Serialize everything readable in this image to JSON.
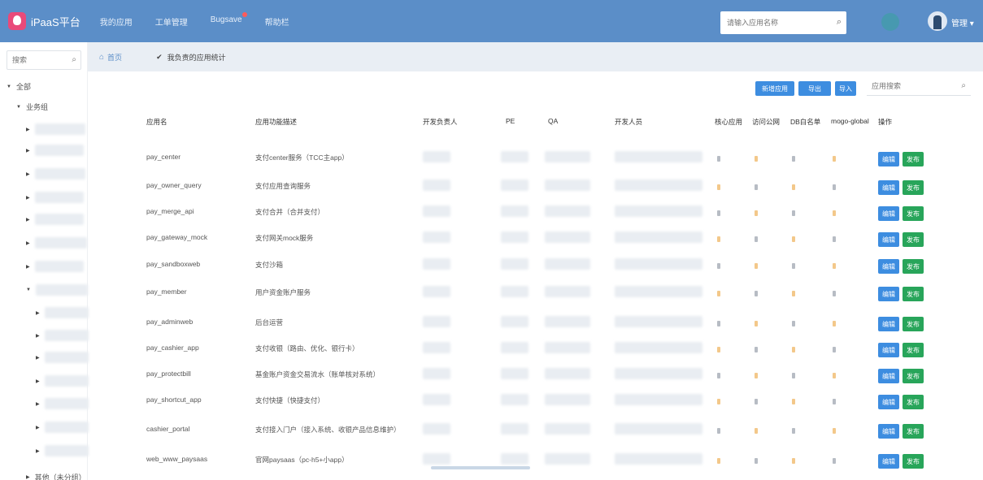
{
  "header": {
    "logo_text": "iPaaS平台",
    "nav": [
      "我的应用",
      "工单管理",
      "Bugsave",
      "帮助栏"
    ],
    "search_placeholder": "请输入应用名称",
    "user_name": "管理",
    "accent_color": "#5b8ec8"
  },
  "sidebar": {
    "search_placeholder": "搜索",
    "tree": [
      {
        "label": "全部",
        "level": 0
      },
      {
        "label": "业务组",
        "level": 1
      }
    ],
    "last_label": "其他（未分组）"
  },
  "subbar": {
    "home_label": "首页",
    "tab_label": "我负责的应用统计"
  },
  "toolbar": {
    "buttons": [
      "新增应用",
      "导出",
      "导入"
    ],
    "search_placeholder": "应用搜索"
  },
  "table": {
    "columns": [
      "应用名",
      "应用功能描述",
      "开发负责人",
      "PE",
      "QA",
      "开发人员",
      "核心应用",
      "访问公网",
      "DB白名单",
      "mogo-global",
      "操作"
    ],
    "edit_label": "编辑",
    "publish_label": "发布",
    "rows": [
      {
        "name": "pay_center",
        "desc": "支付center服务（TCC主app）"
      },
      {
        "name": "pay_owner_query",
        "desc": "支付应用查询服务"
      },
      {
        "name": "pay_merge_api",
        "desc": "支付合并（合并支付）"
      },
      {
        "name": "pay_gateway_mock",
        "desc": "支付网关mock服务"
      },
      {
        "name": "pay_sandboxweb",
        "desc": "支付沙箱"
      },
      {
        "name": "pay_member",
        "desc": "用户资金账户服务"
      },
      {
        "name": "pay_adminweb",
        "desc": "后台运营"
      },
      {
        "name": "pay_cashier_app",
        "desc": "支付收银（路由、优化、银行卡）"
      },
      {
        "name": "pay_protectbill",
        "desc": "基金账户资金交易流水（账单核对系统）"
      },
      {
        "name": "pay_shortcut_app",
        "desc": "支付快捷（快捷支付）"
      },
      {
        "name": "cashier_portal",
        "desc": "支付接入门户（接入系统、收银产品信息维护）"
      },
      {
        "name": "web_www_paysaas",
        "desc": "官网paysaas（pc-h5+小app）"
      }
    ]
  }
}
